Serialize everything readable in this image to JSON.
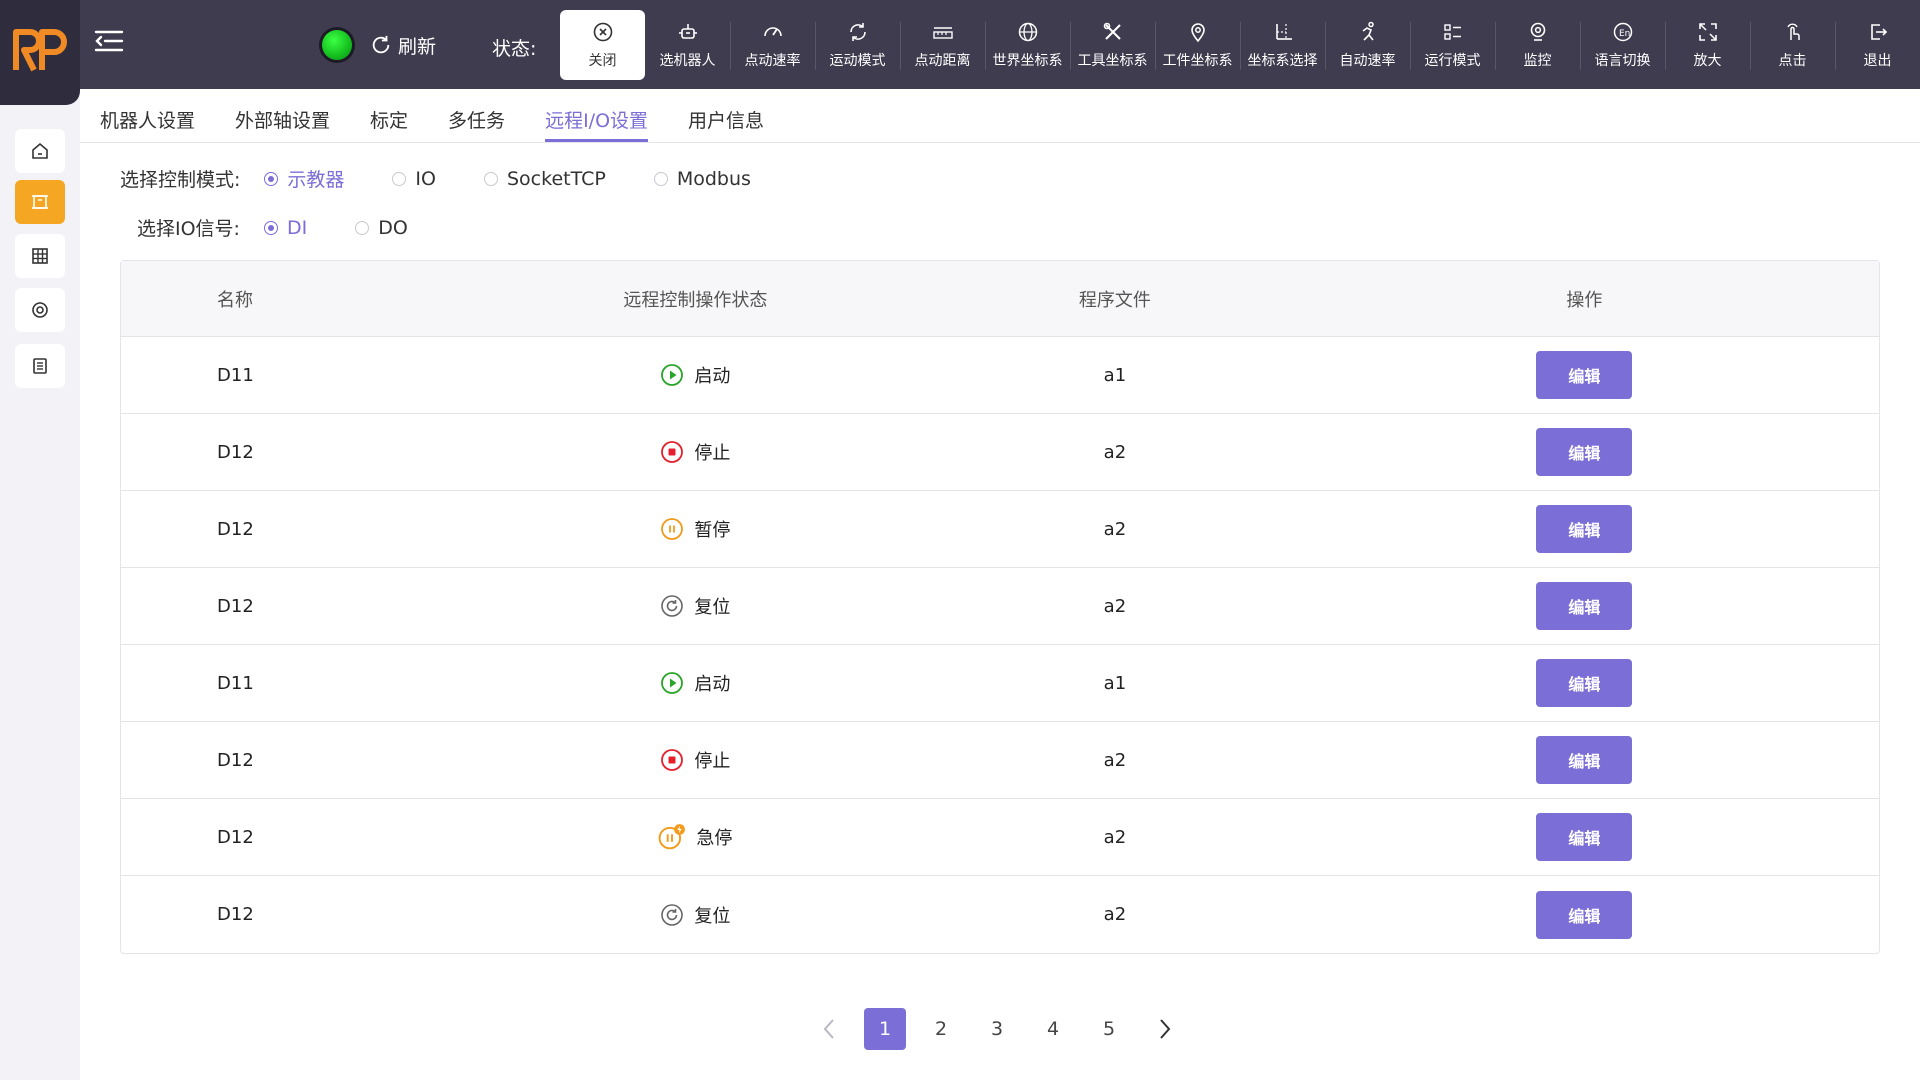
{
  "header": {
    "refresh_label": "刷新",
    "status_label": "状态:",
    "tools": [
      {
        "label": "关闭",
        "icon": "close-circle-icon",
        "active": true
      },
      {
        "label": "选机器人",
        "icon": "robot-icon"
      },
      {
        "label": "点动速率",
        "icon": "speedometer-icon"
      },
      {
        "label": "运动模式",
        "icon": "cycle-icon"
      },
      {
        "label": "点动距离",
        "icon": "ruler-icon"
      },
      {
        "label": "世界坐标系",
        "icon": "globe-icon"
      },
      {
        "label": "工具坐标系",
        "icon": "tools-icon"
      },
      {
        "label": "工件坐标系",
        "icon": "location-pin-icon"
      },
      {
        "label": "坐标系选择",
        "icon": "coordinate-axis-icon"
      },
      {
        "label": "自动速率",
        "icon": "running-man-icon"
      },
      {
        "label": "运行模式",
        "icon": "list-icon"
      },
      {
        "label": "监控",
        "icon": "webcam-icon"
      },
      {
        "label": "语言切换",
        "icon": "language-icon"
      },
      {
        "label": "放大",
        "icon": "expand-icon"
      },
      {
        "label": "点击",
        "icon": "tap-icon"
      },
      {
        "label": "退出",
        "icon": "logout-icon"
      }
    ]
  },
  "sidebar": {
    "items": [
      {
        "icon": "home-icon"
      },
      {
        "icon": "frame-icon",
        "active": true
      },
      {
        "icon": "grid-table-icon"
      },
      {
        "icon": "settings-circle-icon"
      },
      {
        "icon": "list-document-icon"
      }
    ]
  },
  "tabs": [
    "机器人设置",
    "外部轴设置",
    "标定",
    "多任务",
    "远程I/O设置",
    "用户信息"
  ],
  "active_tab": "远程I/O设置",
  "control_mode": {
    "label": "选择控制模式:",
    "options": [
      "示教器",
      "IO",
      "SocketTCP",
      "Modbus"
    ],
    "selected": "示教器"
  },
  "io_signal": {
    "label": "选择IO信号:",
    "options": [
      "DI",
      "DO"
    ],
    "selected": "DI"
  },
  "table": {
    "headers": [
      "名称",
      "远程控制操作状态",
      "程序文件",
      "操作"
    ],
    "rows": [
      {
        "name": "D11",
        "state": "启动",
        "state_type": "start",
        "file": "a1",
        "action": "编辑"
      },
      {
        "name": "D12",
        "state": "停止",
        "state_type": "stop",
        "file": "a2",
        "action": "编辑"
      },
      {
        "name": "D12",
        "state": "暂停",
        "state_type": "pause",
        "file": "a2",
        "action": "编辑"
      },
      {
        "name": "D12",
        "state": "复位",
        "state_type": "reset",
        "file": "a2",
        "action": "编辑"
      },
      {
        "name": "D11",
        "state": "启动",
        "state_type": "start",
        "file": "a1",
        "action": "编辑"
      },
      {
        "name": "D12",
        "state": "停止",
        "state_type": "stop",
        "file": "a2",
        "action": "编辑"
      },
      {
        "name": "D12",
        "state": "急停",
        "state_type": "estop",
        "file": "a2",
        "action": "编辑"
      },
      {
        "name": "D12",
        "state": "复位",
        "state_type": "reset",
        "file": "a2",
        "action": "编辑"
      }
    ]
  },
  "pagination": {
    "pages": [
      "1",
      "2",
      "3",
      "4",
      "5"
    ],
    "current": "1"
  },
  "colors": {
    "accent": "#7b6ed6",
    "topbar": "#3f3c4f",
    "sidebar_active": "#f5a623",
    "start": "#2aa52a",
    "stop": "#e5202e",
    "pause": "#f39b1c",
    "reset": "#666666"
  }
}
